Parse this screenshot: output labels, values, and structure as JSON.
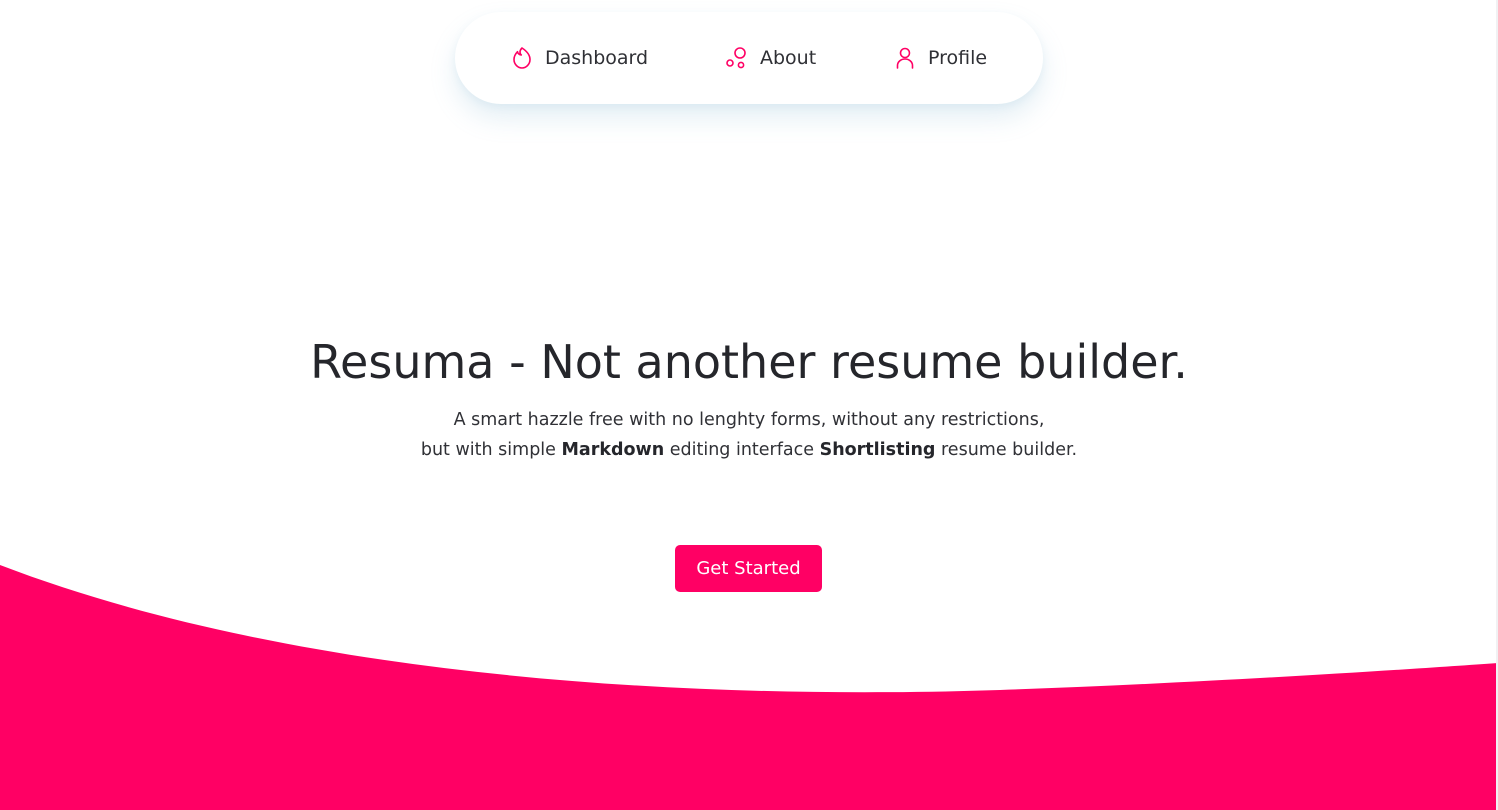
{
  "colors": {
    "accent": "#ff0064",
    "text": "#25262b",
    "background": "#ffffff"
  },
  "nav": {
    "items": [
      {
        "label": "Dashboard",
        "icon": "flame-icon"
      },
      {
        "label": "About",
        "icon": "bubbles-icon"
      },
      {
        "label": "Profile",
        "icon": "user-icon"
      }
    ]
  },
  "hero": {
    "title": "Resuma - Not another resume builder.",
    "subtitle": {
      "line1": "A smart hazzle free with no lenghty forms, without any restrictions,",
      "line2_prefix": "but with simple ",
      "highlight1": "Markdown",
      "line2_middle": " editing interface ",
      "highlight2": "Shortlisting",
      "line2_suffix": " resume builder."
    },
    "cta_label": "Get Started"
  }
}
